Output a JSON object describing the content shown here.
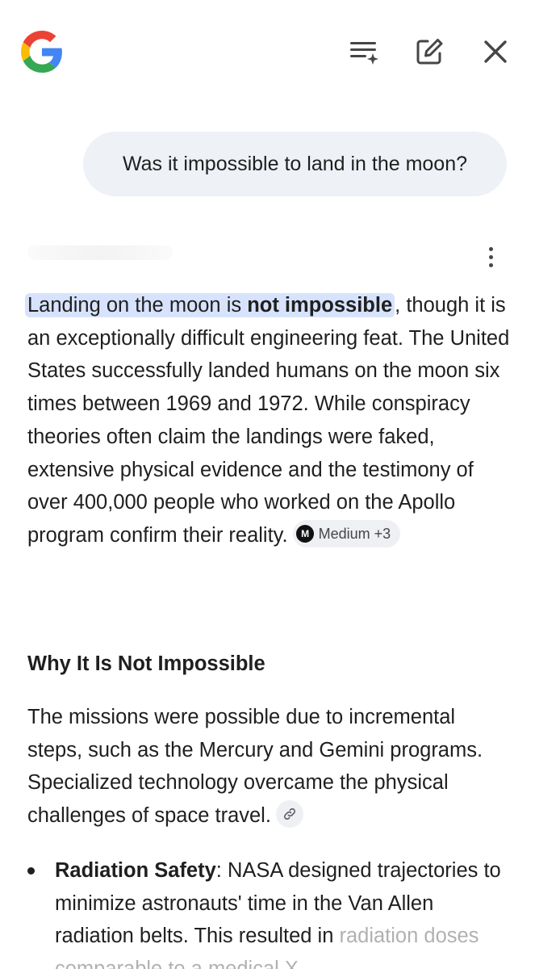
{
  "header": {
    "logo_icon": "google-g-logo",
    "icons": [
      "feed-sparkle-icon",
      "edit-icon",
      "close-icon"
    ]
  },
  "query": {
    "text": "Was it impossible to land in the moon?"
  },
  "answer": {
    "highlight_plain": "Landing on the moon is ",
    "highlight_bold": "not impossible",
    "after_highlight": ",",
    "body": " though it is an exceptionally difficult engineering feat. The United States successfully landed humans on the moon six times between 1969 and 1972. While conspiracy theories often claim the landings were faked, extensive physical evidence and the testimony of over 400,000 people who worked on the Apollo program confirm their reality.",
    "source_chip": {
      "logo_text": "M",
      "label": "Medium +3"
    }
  },
  "section": {
    "heading": "Why It Is Not Impossible",
    "paragraph": "The missions were possible due to incremental steps, such as the Mercury and Gemini programs. Specialized technology overcame the physical challenges of space travel.",
    "link_icon": "link-icon"
  },
  "bullets": [
    {
      "title": "Radiation Safety",
      "text": ": NASA designed trajectories to minimize astronauts' time in the Van Allen radiation belts. This resulted in",
      "cut_line": "radiation doses comparable to a medical X"
    }
  ],
  "colors": {
    "query_bubble": "#eef1f6",
    "highlight": "#d7e3fd",
    "chip_bg": "#eef0f4",
    "text": "#1f1f1f"
  }
}
